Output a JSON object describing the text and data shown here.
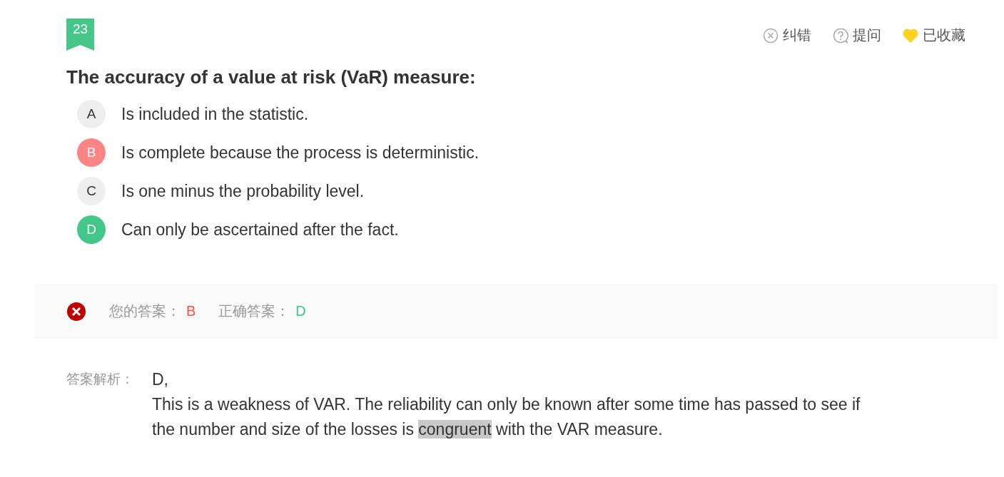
{
  "question_number": "23",
  "actions": [
    {
      "kind": "report",
      "label": "纠错"
    },
    {
      "kind": "ask",
      "label": "提问"
    },
    {
      "kind": "favorite",
      "label": "已收藏",
      "favorited": true
    }
  ],
  "question": "The accuracy of a value at risk (VaR) measure:",
  "options": [
    {
      "letter": "A",
      "text": "Is included in the statistic.",
      "kind": "plain"
    },
    {
      "letter": "B",
      "text": "Is complete because the process is deterministic.",
      "kind": "wrong"
    },
    {
      "letter": "C",
      "text": "Is one minus the probability level.",
      "kind": "plain"
    },
    {
      "letter": "D",
      "text": "Can only be ascertained after the fact.",
      "kind": "correct"
    }
  ],
  "result": {
    "correct": false,
    "your_answer_label": "您的答案：",
    "your_answer": "B",
    "correct_answer_label": "正确答案：",
    "correct_answer": "D"
  },
  "explanation": {
    "label": "答案解析：",
    "lines": [
      [
        {
          "text": "D,",
          "highlighted": false
        }
      ],
      [
        {
          "text": "This is a weakness of VAR. The reliability can only be known after some time has passed to see if",
          "highlighted": false
        }
      ],
      [
        {
          "text": "the number and size of the losses is ",
          "highlighted": false
        },
        {
          "text": "congruent",
          "highlighted": true
        },
        {
          "text": " with the VAR measure.",
          "highlighted": false
        }
      ]
    ]
  }
}
